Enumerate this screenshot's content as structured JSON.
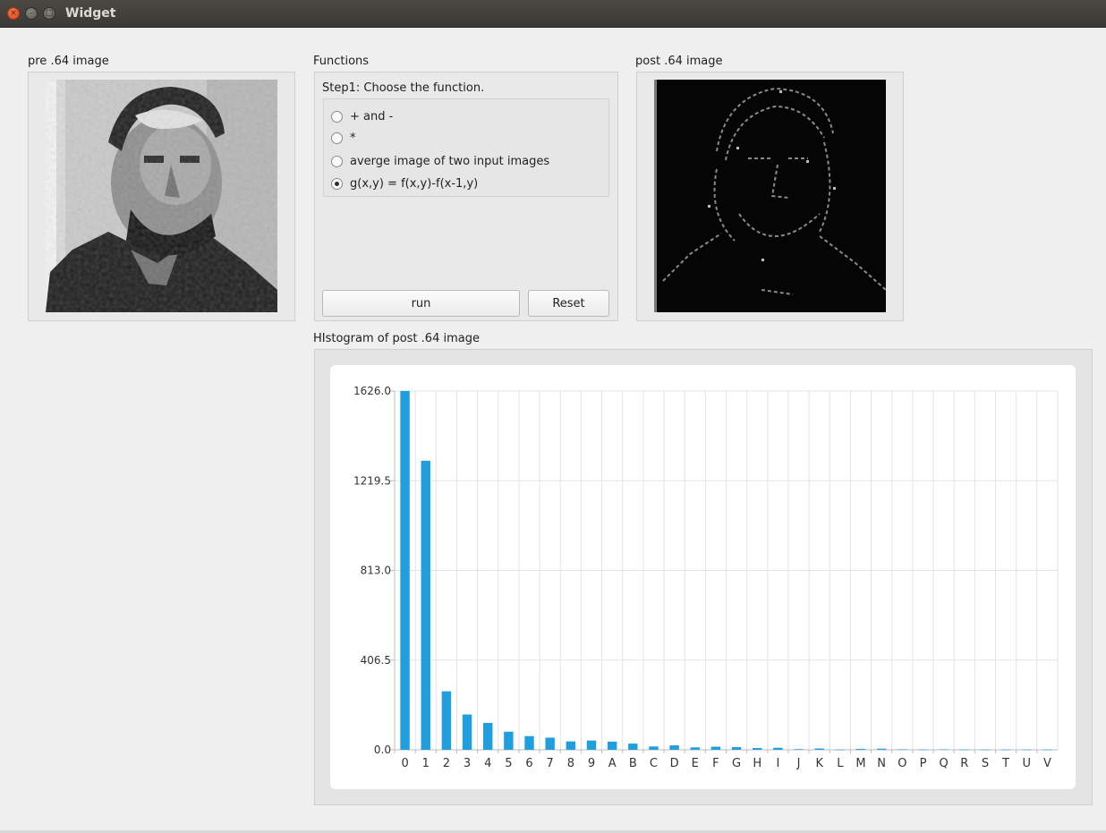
{
  "window": {
    "title": "Widget"
  },
  "labels": {
    "pre_image": "pre .64 image",
    "functions": "Functions",
    "post_image": "post .64 image",
    "histogram": "HIstogram of post .64 image"
  },
  "functions": {
    "step_label": "Step1: Choose the function.",
    "options": [
      {
        "label": "+ and -",
        "selected": false
      },
      {
        "label": "*",
        "selected": false
      },
      {
        "label": "averge image of two input images",
        "selected": false
      },
      {
        "label": "g(x,y) = f(x,y)-f(x-1,y)",
        "selected": true
      }
    ],
    "run_label": "run",
    "reset_label": "Reset"
  },
  "chart_data": {
    "type": "bar",
    "title": "",
    "xlabel": "",
    "ylabel": "",
    "ylim": [
      0,
      1626
    ],
    "y_ticks": [
      "0.0",
      "406.5",
      "813.0",
      "1219.5",
      "1626.0"
    ],
    "categories": [
      "0",
      "1",
      "2",
      "3",
      "4",
      "5",
      "6",
      "7",
      "8",
      "9",
      "A",
      "B",
      "C",
      "D",
      "E",
      "F",
      "G",
      "H",
      "I",
      "J",
      "K",
      "L",
      "M",
      "N",
      "O",
      "P",
      "Q",
      "R",
      "S",
      "T",
      "U",
      "V"
    ],
    "values": [
      1626,
      1310,
      265,
      160,
      122,
      82,
      62,
      55,
      38,
      42,
      37,
      28,
      15,
      20,
      11,
      14,
      12,
      8,
      9,
      3,
      6,
      1,
      4,
      5,
      2,
      1,
      2,
      1,
      1,
      1,
      1,
      1
    ],
    "grid": true,
    "bar_color": "#209fdf"
  }
}
